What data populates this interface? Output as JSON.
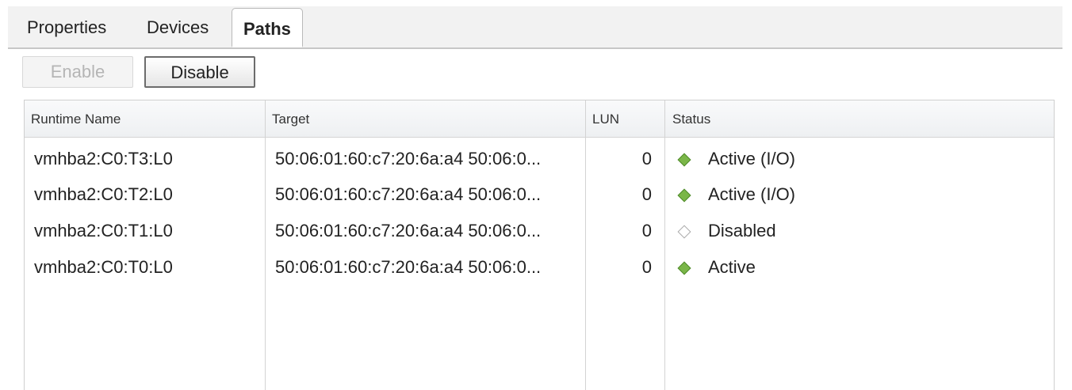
{
  "tabs": [
    {
      "label": "Properties",
      "active": false
    },
    {
      "label": "Devices",
      "active": false
    },
    {
      "label": "Paths",
      "active": true
    }
  ],
  "toolbar": {
    "enable_label": "Enable",
    "enable_disabled": true,
    "disable_label": "Disable",
    "disable_disabled": false
  },
  "table": {
    "columns": [
      "Runtime Name",
      "Target",
      "LUN",
      "Status"
    ],
    "rows": [
      {
        "runtime_name": "vmhba2:C0:T3:L0",
        "target": "50:06:01:60:c7:20:6a:a4 50:06:0...",
        "lun": "0",
        "status": "Active (I/O)",
        "status_icon": "green-diamond-icon"
      },
      {
        "runtime_name": "vmhba2:C0:T2:L0",
        "target": "50:06:01:60:c7:20:6a:a4 50:06:0...",
        "lun": "0",
        "status": "Active (I/O)",
        "status_icon": "green-diamond-icon"
      },
      {
        "runtime_name": "vmhba2:C0:T1:L0",
        "target": "50:06:01:60:c7:20:6a:a4 50:06:0...",
        "lun": "0",
        "status": "Disabled",
        "status_icon": "hollow-diamond-icon"
      },
      {
        "runtime_name": "vmhba2:C0:T0:L0",
        "target": "50:06:01:60:c7:20:6a:a4 50:06:0...",
        "lun": "0",
        "status": "Active",
        "status_icon": "green-diamond-icon"
      }
    ]
  },
  "colors": {
    "status_active": "#7ab648",
    "status_disabled": "#ffffff",
    "grid_border": "#d3d3d3"
  }
}
